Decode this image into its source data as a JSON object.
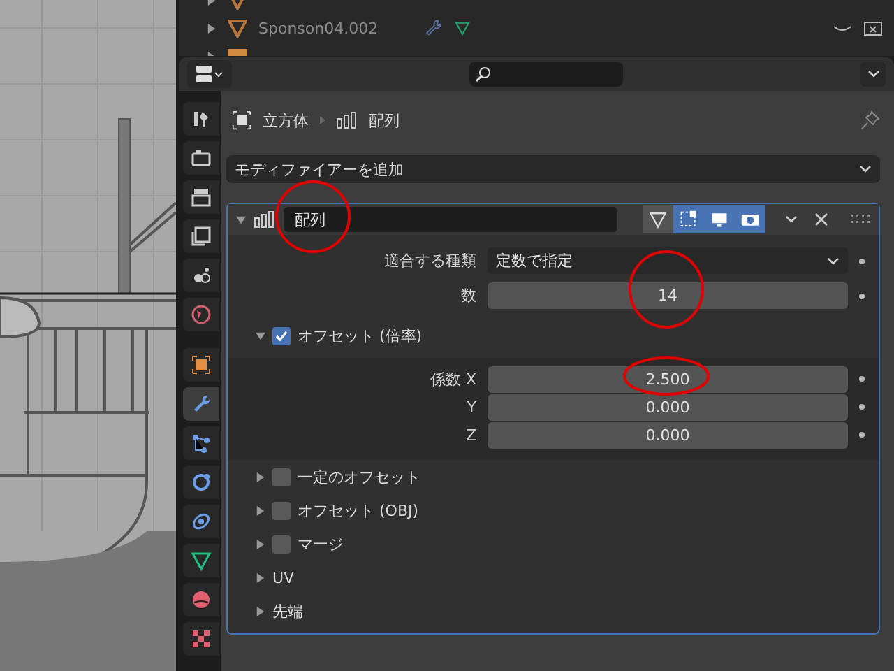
{
  "outliner": {
    "rows": [
      {
        "name": "Sponson04.002"
      }
    ]
  },
  "breadcrumb": {
    "object": "立方体",
    "modifier": "配列"
  },
  "add_modifier": {
    "label": "モディファイアーを追加"
  },
  "tabs": [
    {
      "kind": "tool",
      "selected": false
    },
    {
      "kind": "render",
      "selected": false
    },
    {
      "kind": "output",
      "selected": false
    },
    {
      "kind": "viewlayer",
      "selected": false
    },
    {
      "kind": "scene",
      "selected": false
    },
    {
      "kind": "world",
      "selected": false
    },
    {
      "kind": "object",
      "selected": false
    },
    {
      "kind": "modifier",
      "selected": true
    },
    {
      "kind": "particles",
      "selected": false
    },
    {
      "kind": "physics",
      "selected": false
    },
    {
      "kind": "constraints",
      "selected": false
    },
    {
      "kind": "data",
      "selected": false
    },
    {
      "kind": "material",
      "selected": false
    },
    {
      "kind": "texture",
      "selected": false
    }
  ],
  "modifier": {
    "name": "配列",
    "expanded": true,
    "toggles": [
      {
        "kind": "cage",
        "on": false
      },
      {
        "kind": "editmode",
        "on": true
      },
      {
        "kind": "viewport",
        "on": true
      },
      {
        "kind": "render",
        "on": true
      }
    ],
    "fields": [
      {
        "kind": "dropdown",
        "label": "適合する種類",
        "value": "定数で指定"
      },
      {
        "kind": "number",
        "label": "数",
        "value": "14"
      }
    ],
    "relative_offset": {
      "label": "オフセット (倍率)",
      "expanded": true,
      "checked": true,
      "fields": [
        {
          "label": "係数 X",
          "value": "2.500"
        },
        {
          "label": "Y",
          "value": "0.000"
        },
        {
          "label": "Z",
          "value": "0.000"
        }
      ]
    },
    "subpanels": [
      {
        "kind": "checkbox",
        "label": "一定のオフセット",
        "checked": false,
        "expanded": false
      },
      {
        "kind": "checkbox",
        "label": "オフセット (OBJ)",
        "checked": false,
        "expanded": false
      },
      {
        "kind": "checkbox",
        "label": "マージ",
        "checked": false,
        "expanded": false
      },
      {
        "kind": "plain",
        "label": "UV",
        "expanded": false
      },
      {
        "kind": "plain",
        "label": "先端",
        "expanded": false
      }
    ]
  }
}
